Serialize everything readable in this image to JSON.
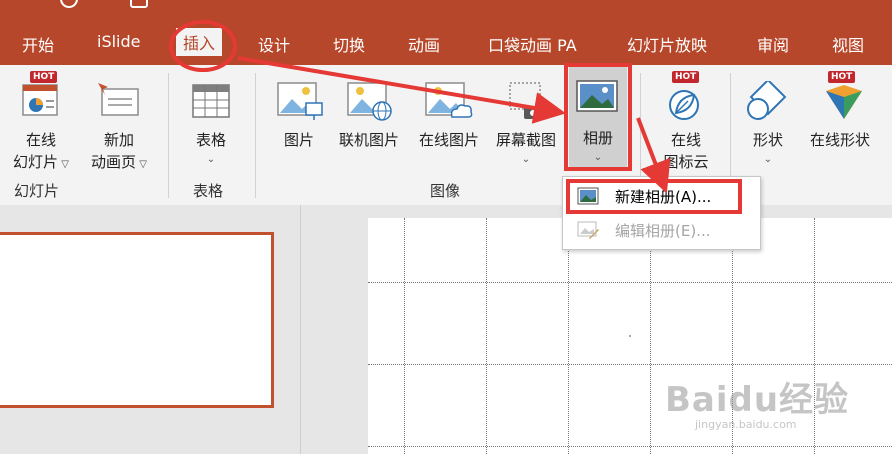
{
  "tabs": [
    {
      "label": "开始",
      "active": false
    },
    {
      "label": "iSlide",
      "active": false
    },
    {
      "label": "插入",
      "active": true
    },
    {
      "label": "设计",
      "active": false
    },
    {
      "label": "切换",
      "active": false
    },
    {
      "label": "动画",
      "active": false
    },
    {
      "label": "口袋动画 PA",
      "active": false
    },
    {
      "label": "幻灯片放映",
      "active": false
    },
    {
      "label": "审阅",
      "active": false
    },
    {
      "label": "视图",
      "active": false
    }
  ],
  "ribbon": {
    "hot_badge": "HOT",
    "groups": {
      "slides": {
        "label": "幻灯片",
        "online_slide": {
          "line1": "在线",
          "line2": "幻灯片"
        },
        "new_anim_page": {
          "line1": "新加",
          "line2": "动画页"
        }
      },
      "table": {
        "label": "表格",
        "table_button": "表格"
      },
      "images": {
        "label": "图像",
        "picture": "图片",
        "online_picture_connected": "联机图片",
        "online_picture": "在线图片",
        "screenshot": "屏幕截图",
        "album": "相册"
      },
      "icon_cloud": {
        "line1": "在线",
        "line2": "图标云"
      },
      "shapes": {
        "shape": "形状",
        "online_shape": "在线形状"
      }
    }
  },
  "album_menu": {
    "items": [
      {
        "label": "新建相册(A)...",
        "enabled": true
      },
      {
        "label": "编辑相册(E)...",
        "enabled": false
      }
    ]
  },
  "watermark": {
    "main": "Baidu经验",
    "sub": "jingyan.baidu.com"
  },
  "colors": {
    "accent": "#b7472a",
    "highlight": "#e53935",
    "ribbon_bg": "#f3f3f3"
  }
}
